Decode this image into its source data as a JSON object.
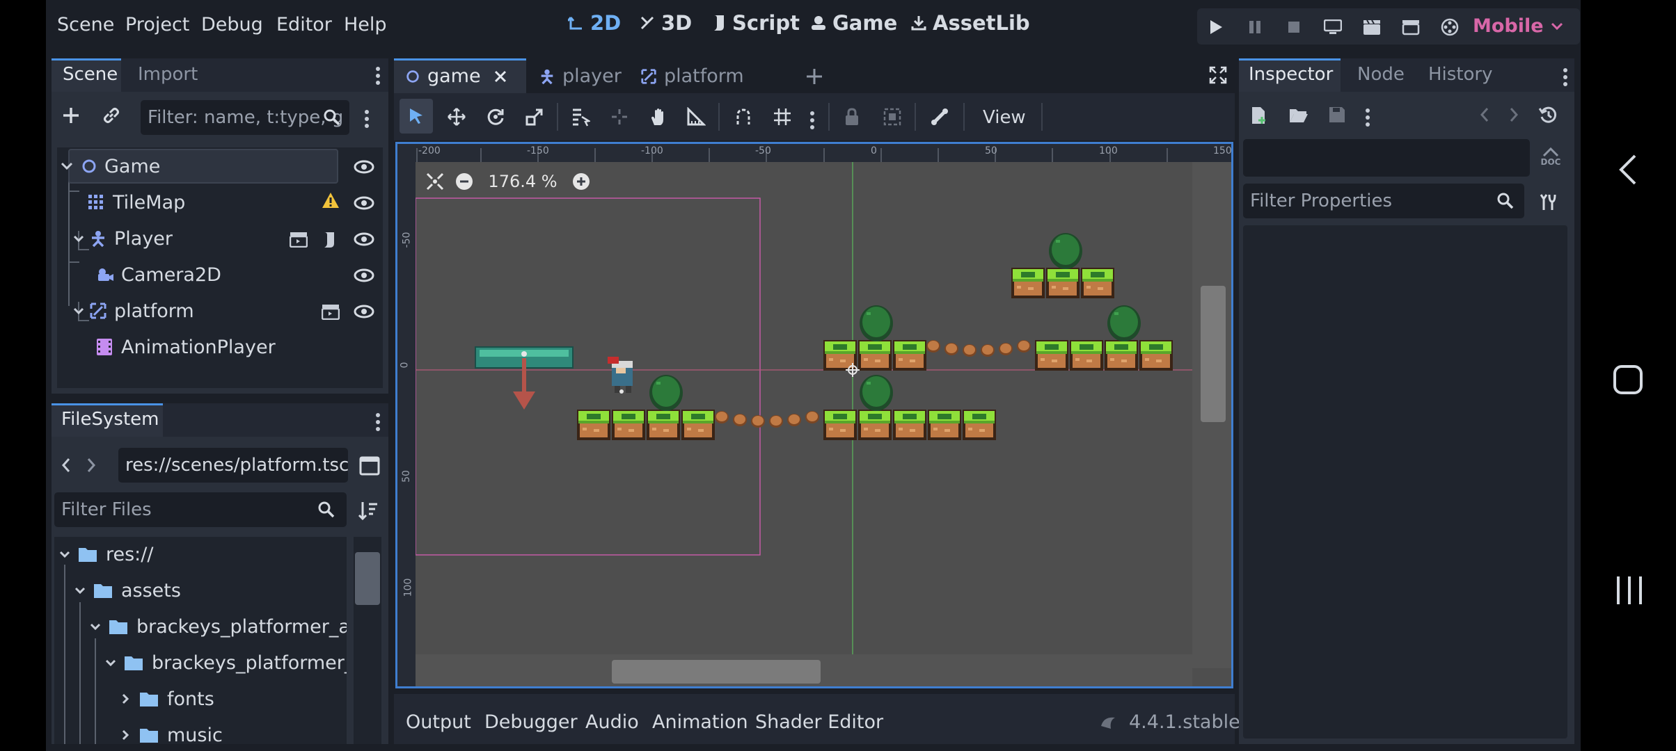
{
  "menu": {
    "items": [
      "Scene",
      "Project",
      "Debug",
      "Editor",
      "Help"
    ]
  },
  "modes": {
    "d2": "2D",
    "d3": "3D",
    "script": "Script",
    "game": "Game",
    "assetlib": "AssetLib"
  },
  "renderer": "Mobile",
  "scene_dock": {
    "tabs": [
      "Scene",
      "Import"
    ],
    "filter_placeholder": "Filter: name, t:type, g",
    "nodes": [
      {
        "label": "Game",
        "icon": "node2d-icon"
      },
      {
        "label": "TileMap",
        "icon": "tilemap-icon",
        "warning": true
      },
      {
        "label": "Player",
        "icon": "characterbody-icon"
      },
      {
        "label": "Camera2D",
        "icon": "camera-icon"
      },
      {
        "label": "platform",
        "icon": "animatablebody-icon"
      },
      {
        "label": "AnimationPlayer",
        "icon": "animationplayer-icon"
      }
    ]
  },
  "filesystem": {
    "tab": "FileSystem",
    "path": "res://scenes/platform.tscn",
    "filter_placeholder": "Filter Files",
    "items": [
      "res://",
      "assets",
      "brackeys_platformer_a...",
      "brackeys_platformer_...",
      "fonts",
      "music"
    ]
  },
  "editor_tabs": [
    "game",
    "player",
    "platform"
  ],
  "toolbar": {
    "view_label": "View"
  },
  "viewport": {
    "zoom": "176.4 %",
    "ruler_x": [
      "-200",
      "-150",
      "-100",
      "-50",
      "0",
      "50",
      "100",
      "150"
    ],
    "ruler_y": [
      "-50",
      "0",
      "50",
      "100"
    ]
  },
  "inspector": {
    "tabs": [
      "Inspector",
      "Node",
      "History"
    ],
    "filter_placeholder": "Filter Properties",
    "doc_label": "DOC"
  },
  "bottom_panel": {
    "tabs": [
      "Output",
      "Debugger",
      "Audio",
      "Animation",
      "Shader Editor"
    ],
    "version": "4.4.1.stable"
  },
  "colors": {
    "accent": "#4a93e6",
    "mode_active": "#6fb0f4",
    "renderer": "#d867a8",
    "background": "#1b1f27",
    "viewport": "#4e4e4e"
  }
}
